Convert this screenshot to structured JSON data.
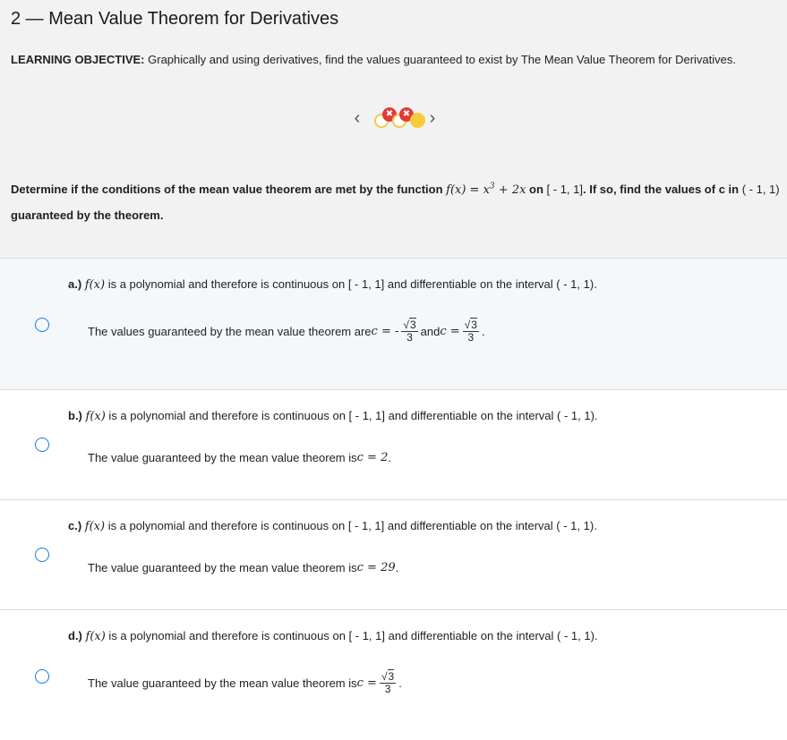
{
  "page": {
    "title": "2 — Mean Value Theorem for Derivatives",
    "objective_label": "LEARNING OBJECTIVE:",
    "objective_text": " Graphically and using derivatives, find the values guaranteed to exist by The Mean Value Theorem for Derivatives."
  },
  "pager": {
    "prev": "‹",
    "next": "›",
    "status_marks": [
      "✖",
      "✖"
    ]
  },
  "question": {
    "p1": "Determine if the conditions of the mean value theorem are met by the function ",
    "func": "f(x) = x",
    "exp": "3",
    "func_rest": " + 2x",
    "on": " on ",
    "interval1": "[ - 1, 1]",
    "p2": ". If so, find the values of ",
    "c": "c",
    "in": " in ",
    "interval2": "( - 1, 1)",
    "p3": " guaranteed by the theorem."
  },
  "options": [
    {
      "letter": "a.)",
      "fx": "f(x)",
      "stmt_mid": " is a polynomial and therefore is continuous on ",
      "closed": "[ - 1, 1]",
      "stmt_mid2": " and differentiable on the interval ",
      "open": "( - 1, 1)",
      "end": ".",
      "answer_prefix": "The values guaranteed by the mean value theorem are ",
      "c_eq": "c = -",
      "f1_num": "3",
      "f1_root": "√",
      "f1_den": "3",
      "and": " and ",
      "c_eq2": "c =",
      "f2_num": "3",
      "f2_root": "√",
      "f2_den": "3",
      "answer_end": "."
    },
    {
      "letter": "b.)",
      "fx": "f(x)",
      "stmt_mid": " is a polynomial and therefore is continuous on ",
      "closed": "[ - 1, 1]",
      "stmt_mid2": " and differentiable on the interval ",
      "open": "( - 1, 1)",
      "end": ".",
      "answer_prefix": "The value guaranteed by the mean value theorem is ",
      "c_eq": "c = 2",
      "answer_end": "."
    },
    {
      "letter": "c.)",
      "fx": "f(x)",
      "stmt_mid": " is a polynomial and therefore is continuous on ",
      "closed": "[ - 1, 1]",
      "stmt_mid2": " and differentiable on the interval ",
      "open": "( - 1, 1)",
      "end": ".",
      "answer_prefix": "The value guaranteed by the mean value theorem is ",
      "c_eq": "c = 29",
      "answer_end": "."
    },
    {
      "letter": "d.)",
      "fx": "f(x)",
      "stmt_mid": " is a polynomial and therefore is continuous on ",
      "closed": "[ - 1, 1]",
      "stmt_mid2": " and differentiable on the interval ",
      "open": "( - 1, 1)",
      "end": ".",
      "answer_prefix": "The value guaranteed by the mean value theorem is ",
      "c_eq": "c =",
      "f1_num": "3",
      "f1_root": "√",
      "f1_den": "3",
      "answer_end": "."
    }
  ]
}
